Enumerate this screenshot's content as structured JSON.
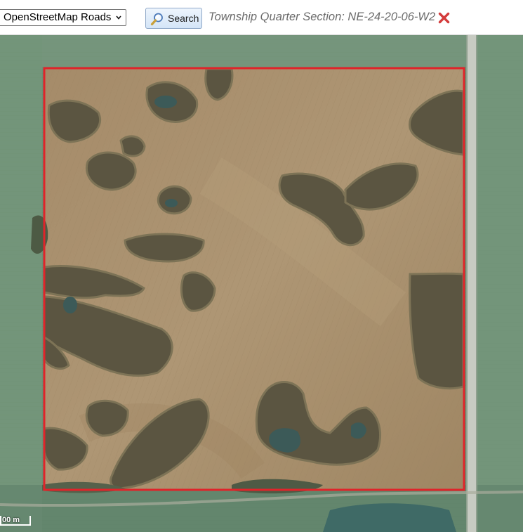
{
  "toolbar": {
    "layer_select_value": "OpenStreetMap Roads",
    "search_label": "Search",
    "query_text": "Township Quarter Section: NE-24-20-06-W2"
  },
  "map": {
    "scale_label": "00 m",
    "boundary_color": "#e0242a"
  },
  "icons": {
    "select_chevron": "chevron-down-icon",
    "search": "magnifier-icon",
    "close": "close-x-icon"
  },
  "colors": {
    "close_icon": "#d43c3c",
    "field_soil": "#a88f6c",
    "crop_green": "#6f9276",
    "sloughs_trees": "#5a5441"
  }
}
